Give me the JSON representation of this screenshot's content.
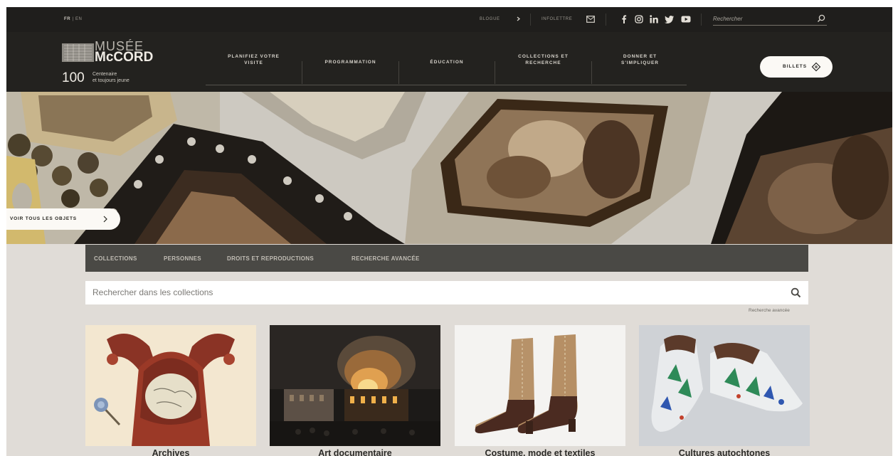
{
  "topbar": {
    "lang_active": "FR",
    "lang_sep": "|",
    "lang_other": "EN",
    "blog": "BLOGUE",
    "newsletter": "INFOLETTRE",
    "search_placeholder": "Rechercher"
  },
  "logo": {
    "musee": "MUSÉE",
    "mccord": "McCORD",
    "centenary": "100",
    "tagline_1": "Centenaire",
    "tagline_2": "et toujours jeune"
  },
  "nav": [
    {
      "line1": "PLANIFIEZ VOTRE",
      "line2": "VISITE"
    },
    {
      "line1": "PROGRAMMATION",
      "line2": ""
    },
    {
      "line1": "ÉDUCATION",
      "line2": ""
    },
    {
      "line1": "COLLECTIONS ET",
      "line2": "RECHERCHE"
    },
    {
      "line1": "DONNER ET",
      "line2": "S'IMPLIQUER"
    }
  ],
  "tickets_label": "BILLETS",
  "hero": {
    "view_all": "VOIR TOUS LES OBJETS"
  },
  "subnav": [
    "COLLECTIONS",
    "PERSONNES",
    "DROITS ET REPRODUCTIONS",
    "RECHERCHE AVANCÉE"
  ],
  "collection_search": {
    "placeholder": "Rechercher dans les collections",
    "advanced": "Recherche avancée"
  },
  "categories": [
    {
      "label": "Archives"
    },
    {
      "label": "Art documentaire"
    },
    {
      "label": "Costume, mode et textiles"
    },
    {
      "label": "Cultures autochtones"
    }
  ],
  "colors": {
    "header_bg": "#23221f",
    "page_bg": "#e0dcd7",
    "subnav_bg": "#4a4945"
  }
}
